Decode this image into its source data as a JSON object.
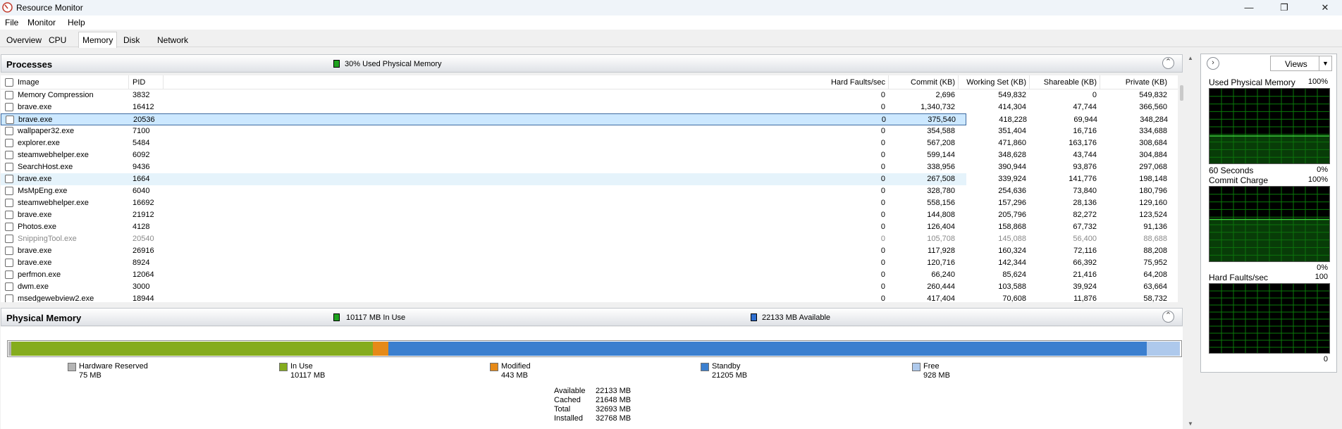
{
  "window": {
    "title": "Resource Monitor"
  },
  "menu": [
    "File",
    "Monitor",
    "Help"
  ],
  "tabs": [
    "Overview",
    "CPU",
    "Memory",
    "Disk",
    "Network"
  ],
  "processes": {
    "title": "Processes",
    "used_physical": "30% Used Physical Memory",
    "columns": [
      "Image",
      "PID",
      "Hard Faults/sec",
      "Commit (KB)",
      "Working Set (KB)",
      "Shareable (KB)",
      "Private (KB)"
    ],
    "rows": [
      {
        "image": "Memory Compression",
        "pid": "3832",
        "hf": "0",
        "commit": "2,696",
        "ws": "549,832",
        "share": "0",
        "private": "549,832"
      },
      {
        "image": "brave.exe",
        "pid": "16412",
        "hf": "0",
        "commit": "1,340,732",
        "ws": "414,304",
        "share": "47,744",
        "private": "366,560"
      },
      {
        "image": "brave.exe",
        "pid": "20536",
        "hf": "0",
        "commit": "375,540",
        "ws": "418,228",
        "share": "69,944",
        "private": "348,284"
      },
      {
        "image": "wallpaper32.exe",
        "pid": "7100",
        "hf": "0",
        "commit": "354,588",
        "ws": "351,404",
        "share": "16,716",
        "private": "334,688"
      },
      {
        "image": "explorer.exe",
        "pid": "5484",
        "hf": "0",
        "commit": "567,208",
        "ws": "471,860",
        "share": "163,176",
        "private": "308,684"
      },
      {
        "image": "steamwebhelper.exe",
        "pid": "6092",
        "hf": "0",
        "commit": "599,144",
        "ws": "348,628",
        "share": "43,744",
        "private": "304,884"
      },
      {
        "image": "SearchHost.exe",
        "pid": "9436",
        "hf": "0",
        "commit": "338,956",
        "ws": "390,944",
        "share": "93,876",
        "private": "297,068"
      },
      {
        "image": "brave.exe",
        "pid": "1664",
        "hf": "0",
        "commit": "267,508",
        "ws": "339,924",
        "share": "141,776",
        "private": "198,148"
      },
      {
        "image": "MsMpEng.exe",
        "pid": "6040",
        "hf": "0",
        "commit": "328,780",
        "ws": "254,636",
        "share": "73,840",
        "private": "180,796"
      },
      {
        "image": "steamwebhelper.exe",
        "pid": "16692",
        "hf": "0",
        "commit": "558,156",
        "ws": "157,296",
        "share": "28,136",
        "private": "129,160"
      },
      {
        "image": "brave.exe",
        "pid": "21912",
        "hf": "0",
        "commit": "144,808",
        "ws": "205,796",
        "share": "82,272",
        "private": "123,524"
      },
      {
        "image": "Photos.exe",
        "pid": "4128",
        "hf": "0",
        "commit": "126,404",
        "ws": "158,868",
        "share": "67,732",
        "private": "91,136"
      },
      {
        "image": "SnippingTool.exe",
        "pid": "20540",
        "hf": "0",
        "commit": "105,708",
        "ws": "145,088",
        "share": "56,400",
        "private": "88,688"
      },
      {
        "image": "brave.exe",
        "pid": "26916",
        "hf": "0",
        "commit": "117,928",
        "ws": "160,324",
        "share": "72,116",
        "private": "88,208"
      },
      {
        "image": "brave.exe",
        "pid": "8924",
        "hf": "0",
        "commit": "120,716",
        "ws": "142,344",
        "share": "66,392",
        "private": "75,952"
      },
      {
        "image": "perfmon.exe",
        "pid": "12064",
        "hf": "0",
        "commit": "66,240",
        "ws": "85,624",
        "share": "21,416",
        "private": "64,208"
      },
      {
        "image": "dwm.exe",
        "pid": "3000",
        "hf": "0",
        "commit": "260,444",
        "ws": "103,588",
        "share": "39,924",
        "private": "63,664"
      },
      {
        "image": "msedgewebview2.exe",
        "pid": "18944",
        "hf": "0",
        "commit": "417,404",
        "ws": "70,608",
        "share": "11,876",
        "private": "58,732"
      }
    ]
  },
  "physical_memory": {
    "title": "Physical Memory",
    "in_use": "10117 MB In Use",
    "available": "22133 MB Available",
    "bar_mb": {
      "hardware_reserved": 75,
      "in_use": 10117,
      "modified": 443,
      "standby": 21205,
      "free": 928
    },
    "legend": [
      {
        "label": "Hardware Reserved",
        "value": "75 MB",
        "color": "#b4b4b4"
      },
      {
        "label": "In Use",
        "value": "10117 MB",
        "color": "#85ac1e"
      },
      {
        "label": "Modified",
        "value": "443 MB",
        "color": "#e68a18"
      },
      {
        "label": "Standby",
        "value": "21205 MB",
        "color": "#3b7fcf"
      },
      {
        "label": "Free",
        "value": "928 MB",
        "color": "#aec9ec"
      }
    ],
    "stats": [
      {
        "label": "Available",
        "value": "22133 MB"
      },
      {
        "label": "Cached",
        "value": "21648 MB"
      },
      {
        "label": "Total",
        "value": "32693 MB"
      },
      {
        "label": "Installed",
        "value": "32768 MB"
      }
    ]
  },
  "right": {
    "views_label": "Views",
    "graphs": [
      {
        "title": "Used Physical Memory",
        "max": "100%",
        "bottom_left": "60 Seconds",
        "min": "0%"
      },
      {
        "title": "Commit Charge",
        "max": "100%",
        "bottom_left": "",
        "min": "0%"
      },
      {
        "title": "Hard Faults/sec",
        "max": "100",
        "bottom_left": "",
        "min": "0"
      }
    ]
  }
}
